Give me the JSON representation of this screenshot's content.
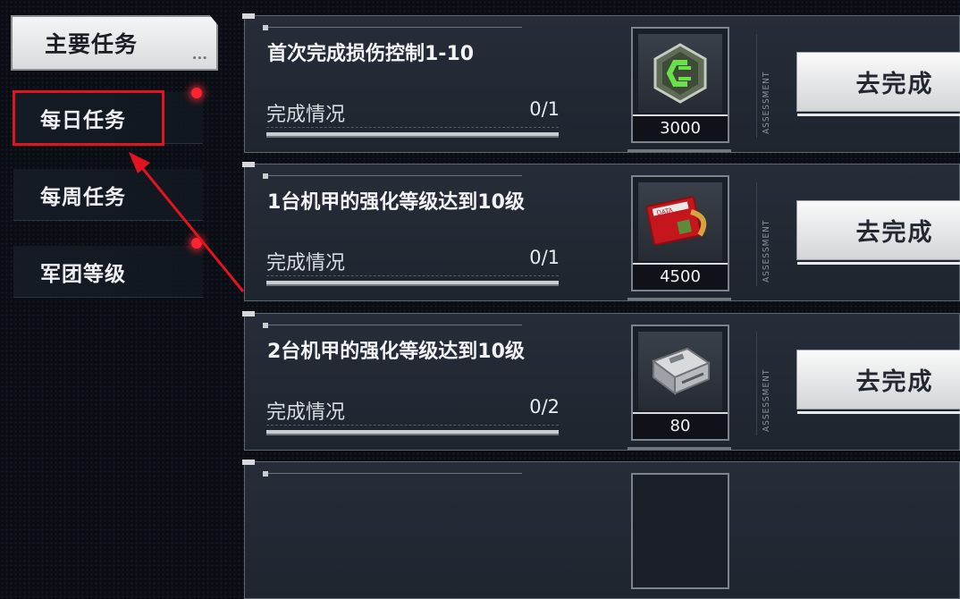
{
  "sidebar": {
    "main_tab": "主要任务",
    "items": [
      {
        "label": "每日任务",
        "selected": true,
        "has_notification": true
      },
      {
        "label": "每周任务",
        "selected": false,
        "has_notification": false
      },
      {
        "label": "军团等级",
        "selected": false,
        "has_notification": true
      }
    ]
  },
  "tasks": [
    {
      "title": "首次完成损伤控制1-10",
      "progress_label": "完成情况",
      "progress_text": "0/1",
      "progress": 0,
      "reward_icon": "green-chip-icon",
      "reward_amount": "3000",
      "assessment": "ASSESSMENT",
      "button_label": "去完成"
    },
    {
      "title": "1台机甲的强化等级达到10级",
      "progress_label": "完成情况",
      "progress_text": "0/1",
      "progress": 0,
      "reward_icon": "data-chip-icon",
      "reward_amount": "4500",
      "assessment": "ASSESSMENT",
      "button_label": "去完成"
    },
    {
      "title": "2台机甲的强化等级达到10级",
      "progress_label": "完成情况",
      "progress_text": "0/2",
      "progress": 0,
      "reward_icon": "metal-case-icon",
      "reward_amount": "80",
      "assessment": "ASSESSMENT",
      "button_label": "去完成"
    }
  ],
  "colors": {
    "highlight": "#e3141f",
    "notification": "#ff2430"
  }
}
